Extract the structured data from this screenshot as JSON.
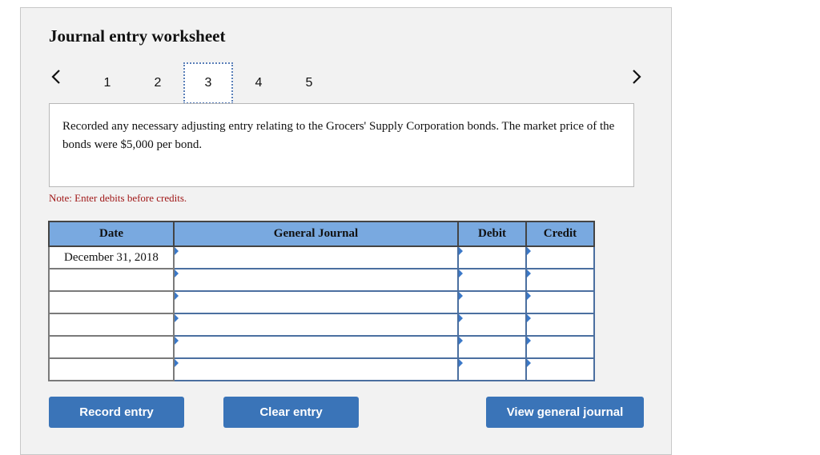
{
  "worksheet": {
    "title": "Journal entry worksheet",
    "nav": {
      "prev_icon": "chevron-left-icon",
      "next_icon": "chevron-right-icon",
      "steps": [
        "1",
        "2",
        "3",
        "4",
        "5"
      ],
      "active_step": "3"
    },
    "description": "Recorded any necessary adjusting entry relating to the Grocers' Supply Corporation bonds. The market price of the bonds were $5,000 per bond.",
    "note": "Note: Enter debits before credits.",
    "table": {
      "headers": [
        "Date",
        "General Journal",
        "Debit",
        "Credit"
      ],
      "rows": [
        {
          "date": "December 31, 2018",
          "account": "",
          "debit": "",
          "credit": ""
        },
        {
          "date": "",
          "account": "",
          "debit": "",
          "credit": ""
        },
        {
          "date": "",
          "account": "",
          "debit": "",
          "credit": ""
        },
        {
          "date": "",
          "account": "",
          "debit": "",
          "credit": ""
        },
        {
          "date": "",
          "account": "",
          "debit": "",
          "credit": ""
        },
        {
          "date": "",
          "account": "",
          "debit": "",
          "credit": ""
        }
      ]
    },
    "buttons": {
      "record": "Record entry",
      "clear": "Clear entry",
      "view": "View general journal"
    },
    "colors": {
      "header_blue": "#79a9e0",
      "button_blue": "#3a74b8",
      "note_red": "#a01818",
      "active_step_border": "#5a7fb8"
    }
  }
}
